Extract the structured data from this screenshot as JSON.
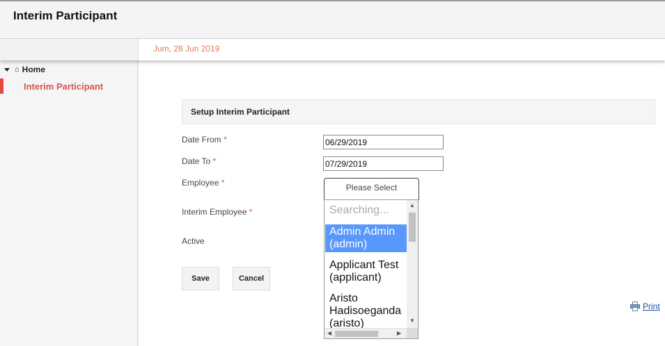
{
  "header": {
    "title": "Interim Participant"
  },
  "datebar": {
    "date": "Jum, 28 Jun 2019"
  },
  "sidebar": {
    "home_label": "Home",
    "active_item": "Interim Participant"
  },
  "form": {
    "section_title": "Setup Interim Participant",
    "required_mark": "*",
    "date_from": {
      "label": "Date From",
      "value": "06/29/2019"
    },
    "date_to": {
      "label": "Date To",
      "value": "07/29/2019"
    },
    "employee": {
      "label": "Employee",
      "placeholder": "Please Select"
    },
    "interim_employee": {
      "label": "Interim Employee"
    },
    "active": {
      "label": "Active"
    },
    "save_label": "Save",
    "cancel_label": "Cancel"
  },
  "dropdown": {
    "search_placeholder": "Searching...",
    "options": [
      {
        "line1": "Admin Admin",
        "line2": "(admin)",
        "selected": true
      },
      {
        "line1": "Applicant Test",
        "line2": "(applicant)",
        "selected": false
      },
      {
        "line1": "Aristo",
        "line2": "Hadisoeganda",
        "line3": "(aristo)",
        "selected": false
      }
    ]
  },
  "print": {
    "label": "Print"
  },
  "colors": {
    "accent_red": "#e8473c",
    "date_text": "#e07a5a",
    "dropdown_highlight": "#5897fb",
    "link_blue": "#1a4ea6"
  }
}
